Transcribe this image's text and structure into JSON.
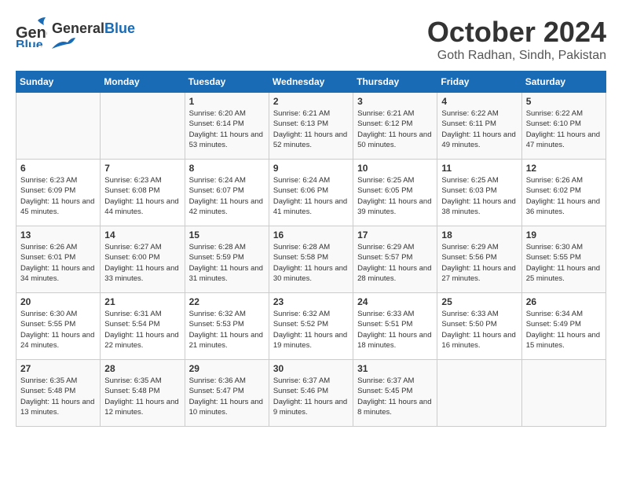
{
  "header": {
    "logo_general": "General",
    "logo_blue": "Blue",
    "month": "October 2024",
    "location": "Goth Radhan, Sindh, Pakistan"
  },
  "days_of_week": [
    "Sunday",
    "Monday",
    "Tuesday",
    "Wednesday",
    "Thursday",
    "Friday",
    "Saturday"
  ],
  "weeks": [
    [
      {
        "day": "",
        "content": ""
      },
      {
        "day": "",
        "content": ""
      },
      {
        "day": "1",
        "content": "Sunrise: 6:20 AM\nSunset: 6:14 PM\nDaylight: 11 hours and 53 minutes."
      },
      {
        "day": "2",
        "content": "Sunrise: 6:21 AM\nSunset: 6:13 PM\nDaylight: 11 hours and 52 minutes."
      },
      {
        "day": "3",
        "content": "Sunrise: 6:21 AM\nSunset: 6:12 PM\nDaylight: 11 hours and 50 minutes."
      },
      {
        "day": "4",
        "content": "Sunrise: 6:22 AM\nSunset: 6:11 PM\nDaylight: 11 hours and 49 minutes."
      },
      {
        "day": "5",
        "content": "Sunrise: 6:22 AM\nSunset: 6:10 PM\nDaylight: 11 hours and 47 minutes."
      }
    ],
    [
      {
        "day": "6",
        "content": "Sunrise: 6:23 AM\nSunset: 6:09 PM\nDaylight: 11 hours and 45 minutes."
      },
      {
        "day": "7",
        "content": "Sunrise: 6:23 AM\nSunset: 6:08 PM\nDaylight: 11 hours and 44 minutes."
      },
      {
        "day": "8",
        "content": "Sunrise: 6:24 AM\nSunset: 6:07 PM\nDaylight: 11 hours and 42 minutes."
      },
      {
        "day": "9",
        "content": "Sunrise: 6:24 AM\nSunset: 6:06 PM\nDaylight: 11 hours and 41 minutes."
      },
      {
        "day": "10",
        "content": "Sunrise: 6:25 AM\nSunset: 6:05 PM\nDaylight: 11 hours and 39 minutes."
      },
      {
        "day": "11",
        "content": "Sunrise: 6:25 AM\nSunset: 6:03 PM\nDaylight: 11 hours and 38 minutes."
      },
      {
        "day": "12",
        "content": "Sunrise: 6:26 AM\nSunset: 6:02 PM\nDaylight: 11 hours and 36 minutes."
      }
    ],
    [
      {
        "day": "13",
        "content": "Sunrise: 6:26 AM\nSunset: 6:01 PM\nDaylight: 11 hours and 34 minutes."
      },
      {
        "day": "14",
        "content": "Sunrise: 6:27 AM\nSunset: 6:00 PM\nDaylight: 11 hours and 33 minutes."
      },
      {
        "day": "15",
        "content": "Sunrise: 6:28 AM\nSunset: 5:59 PM\nDaylight: 11 hours and 31 minutes."
      },
      {
        "day": "16",
        "content": "Sunrise: 6:28 AM\nSunset: 5:58 PM\nDaylight: 11 hours and 30 minutes."
      },
      {
        "day": "17",
        "content": "Sunrise: 6:29 AM\nSunset: 5:57 PM\nDaylight: 11 hours and 28 minutes."
      },
      {
        "day": "18",
        "content": "Sunrise: 6:29 AM\nSunset: 5:56 PM\nDaylight: 11 hours and 27 minutes."
      },
      {
        "day": "19",
        "content": "Sunrise: 6:30 AM\nSunset: 5:55 PM\nDaylight: 11 hours and 25 minutes."
      }
    ],
    [
      {
        "day": "20",
        "content": "Sunrise: 6:30 AM\nSunset: 5:55 PM\nDaylight: 11 hours and 24 minutes."
      },
      {
        "day": "21",
        "content": "Sunrise: 6:31 AM\nSunset: 5:54 PM\nDaylight: 11 hours and 22 minutes."
      },
      {
        "day": "22",
        "content": "Sunrise: 6:32 AM\nSunset: 5:53 PM\nDaylight: 11 hours and 21 minutes."
      },
      {
        "day": "23",
        "content": "Sunrise: 6:32 AM\nSunset: 5:52 PM\nDaylight: 11 hours and 19 minutes."
      },
      {
        "day": "24",
        "content": "Sunrise: 6:33 AM\nSunset: 5:51 PM\nDaylight: 11 hours and 18 minutes."
      },
      {
        "day": "25",
        "content": "Sunrise: 6:33 AM\nSunset: 5:50 PM\nDaylight: 11 hours and 16 minutes."
      },
      {
        "day": "26",
        "content": "Sunrise: 6:34 AM\nSunset: 5:49 PM\nDaylight: 11 hours and 15 minutes."
      }
    ],
    [
      {
        "day": "27",
        "content": "Sunrise: 6:35 AM\nSunset: 5:48 PM\nDaylight: 11 hours and 13 minutes."
      },
      {
        "day": "28",
        "content": "Sunrise: 6:35 AM\nSunset: 5:48 PM\nDaylight: 11 hours and 12 minutes."
      },
      {
        "day": "29",
        "content": "Sunrise: 6:36 AM\nSunset: 5:47 PM\nDaylight: 11 hours and 10 minutes."
      },
      {
        "day": "30",
        "content": "Sunrise: 6:37 AM\nSunset: 5:46 PM\nDaylight: 11 hours and 9 minutes."
      },
      {
        "day": "31",
        "content": "Sunrise: 6:37 AM\nSunset: 5:45 PM\nDaylight: 11 hours and 8 minutes."
      },
      {
        "day": "",
        "content": ""
      },
      {
        "day": "",
        "content": ""
      }
    ]
  ]
}
